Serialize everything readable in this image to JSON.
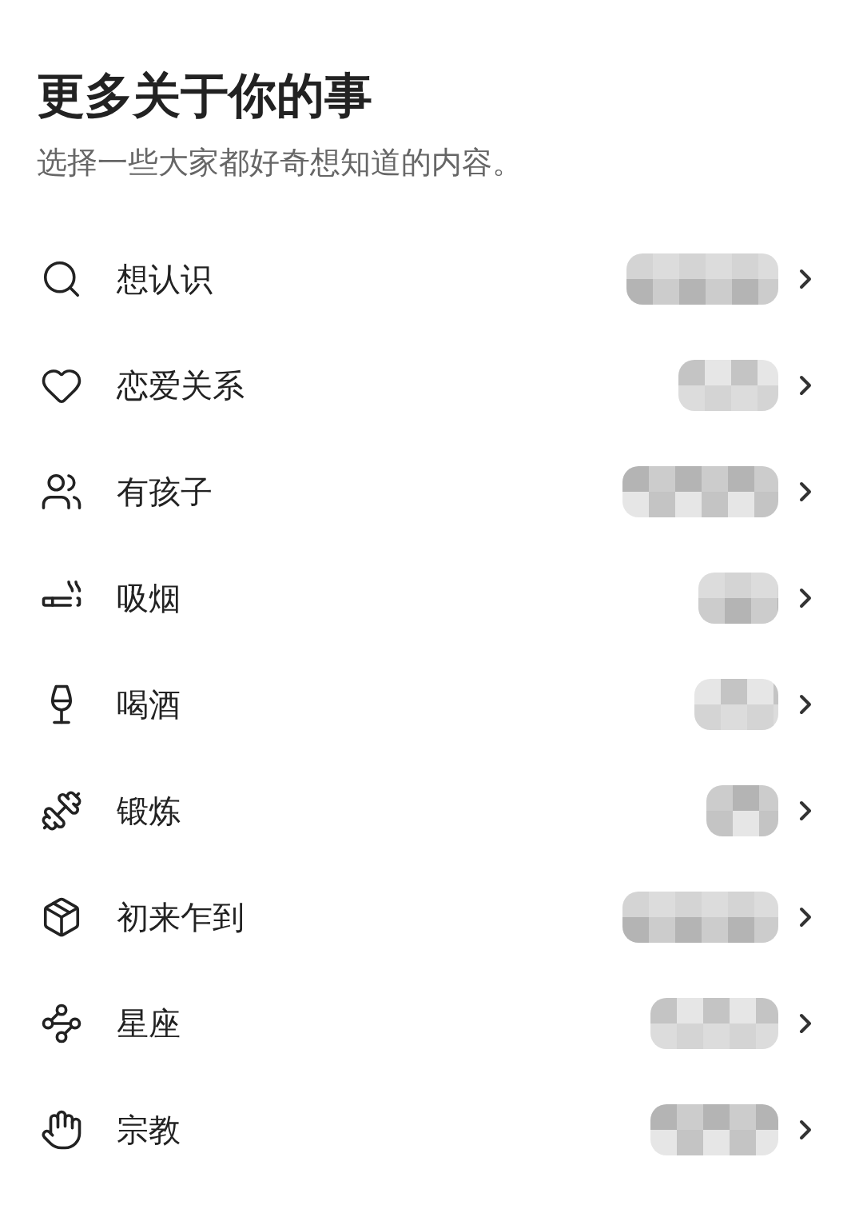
{
  "header": {
    "title": "更多关于你的事",
    "subtitle": "选择一些大家都好奇想知道的内容。"
  },
  "items": [
    {
      "label": "想认识"
    },
    {
      "label": "恋爱关系"
    },
    {
      "label": "有孩子"
    },
    {
      "label": "吸烟"
    },
    {
      "label": "喝酒"
    },
    {
      "label": "锻炼"
    },
    {
      "label": "初来乍到"
    },
    {
      "label": "星座"
    },
    {
      "label": "宗教"
    }
  ]
}
